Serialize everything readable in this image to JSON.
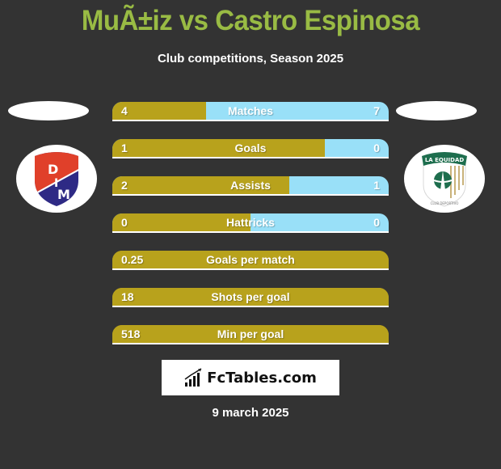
{
  "header": {
    "title": "MuÃ±iz vs Castro Espinosa",
    "subtitle": "Club competitions, Season 2025"
  },
  "teams": {
    "left": {
      "name": "DIM",
      "logo_letters": [
        "D",
        "I",
        "M"
      ],
      "colors": {
        "top": "#e0402a",
        "bottom": "#2e2a85"
      }
    },
    "right": {
      "name": "La Equidad",
      "logo_text_top": "LA EQUIDAD",
      "logo_text_bottom": "CLUB DEPORTIVO",
      "colors": {
        "green": "#1e6e4e",
        "gold": "#c9b27a"
      }
    }
  },
  "colors": {
    "left_fill": "#b8a21c",
    "right_fill": "#99e0f8",
    "title": "#99bb44",
    "background": "#333333"
  },
  "stats": [
    {
      "label": "Matches",
      "left": "4",
      "right": "7",
      "left_share": 0.34
    },
    {
      "label": "Goals",
      "left": "1",
      "right": "0",
      "left_share": 0.77
    },
    {
      "label": "Assists",
      "left": "2",
      "right": "1",
      "left_share": 0.64
    },
    {
      "label": "Hattricks",
      "left": "0",
      "right": "0",
      "left_share": 0.5
    },
    {
      "label": "Goals per match",
      "left": "0.25",
      "right": "",
      "left_share": 1.0
    },
    {
      "label": "Shots per goal",
      "left": "18",
      "right": "",
      "left_share": 1.0
    },
    {
      "label": "Min per goal",
      "left": "518",
      "right": "",
      "left_share": 1.0
    }
  ],
  "footer": {
    "brand": "FcTables.com",
    "brand_icon": "bar-chart-icon",
    "date": "9 march 2025"
  }
}
